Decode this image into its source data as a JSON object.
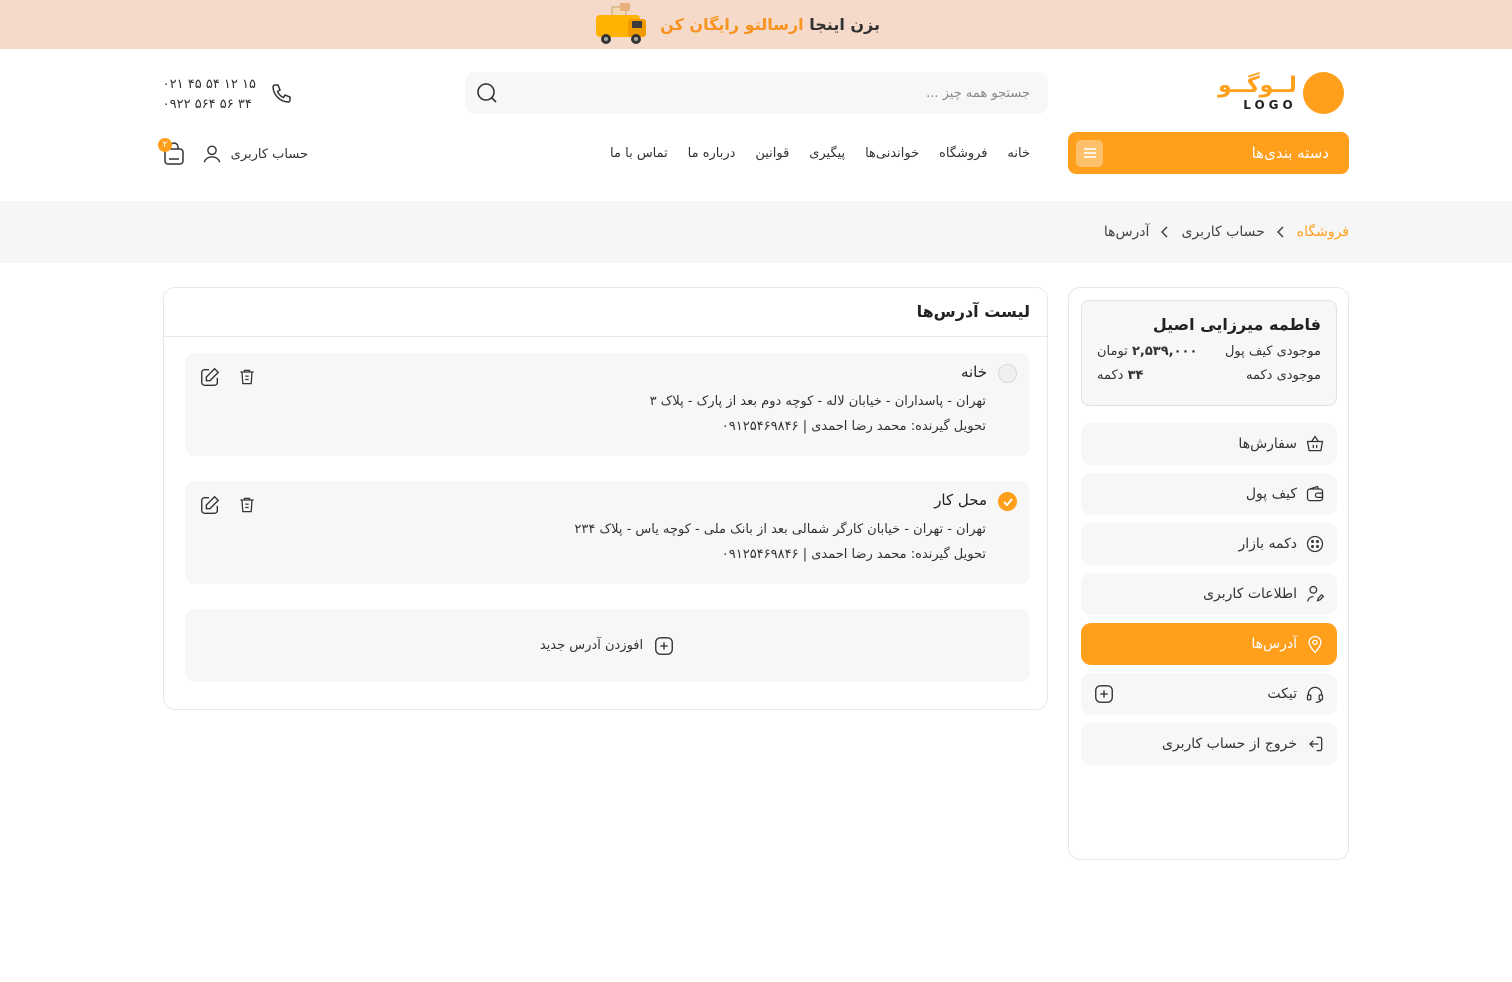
{
  "banner": {
    "prefix": "بزن اینجا",
    "highlight": "ارسالتو رایگان کن",
    "icon": "delivery-truck-icon"
  },
  "logo": {
    "fa": "لــوگــو",
    "en": "LOGO"
  },
  "search": {
    "placeholder": "جستجو همه چیز ...",
    "value": ""
  },
  "phones": [
    "۰۲۱ ۴۵ ۵۴ ۱۲ ۱۵",
    "۰۹۲۲ ۵۶۴ ۵۶ ۳۴"
  ],
  "categories_button": "دسته بندی‌ها",
  "nav": [
    "خانه",
    "فروشگاه",
    "خواندنی‌ها",
    "پیگیری",
    "قوانین",
    "درباره ما",
    "تماس با ما"
  ],
  "account": {
    "label": "حساب کاربری",
    "cart_count": "۲"
  },
  "breadcrumb": [
    "فروشگاه",
    "حساب کاربری",
    "آدرس‌ها"
  ],
  "user": {
    "name": "فاطمه میرزایی اصیل",
    "wallet_label": "موجودی کیف پول",
    "wallet_value": "۲,۵۳۹,۰۰۰",
    "wallet_unit": "تومان",
    "coins_label": "موجودی دکمه",
    "coins_value": "۳۴",
    "coins_unit": "دکمه"
  },
  "menu": [
    {
      "label": "سفارش‌ها",
      "icon": "basket-icon",
      "active": false
    },
    {
      "label": "کیف پول",
      "icon": "wallet-icon",
      "active": false
    },
    {
      "label": "دکمه بازار",
      "icon": "button-coin-icon",
      "active": false
    },
    {
      "label": "اطلاعات کاربری",
      "icon": "user-edit-icon",
      "active": false
    },
    {
      "label": "آدرس‌ها",
      "icon": "location-pin-icon",
      "active": true
    },
    {
      "label": "تیکت",
      "icon": "headset-icon",
      "active": false
    },
    {
      "label": "خروج از حساب کاربری",
      "icon": "logout-icon",
      "active": false
    }
  ],
  "panel": {
    "title": "لیست آدرس‌ها",
    "addresses": [
      {
        "title": "خانه",
        "line": "تهران - پاسداران - خیابان لاله - کوچه دوم بعد از پارک - پلاک ۳",
        "recipient": "تحویل گیرنده: محمد رضا احمدی | ۰۹۱۲۵۴۶۹۸۴۶",
        "selected": false
      },
      {
        "title": "محل کار",
        "line": "تهران - تهران - خیابان کارگر شمالی بعد از بانک ملی - کوچه یاس - پلاک ۲۳۴",
        "recipient": "تحویل گیرنده: محمد رضا احمدی | ۰۹۱۲۵۴۶۹۸۴۶",
        "selected": true
      }
    ],
    "add_label": "افوزدن آدرس جدید"
  },
  "colors": {
    "accent": "#ff9f1c",
    "banner_bg": "#f5d9c9",
    "card_bg": "#f7f7f7"
  }
}
